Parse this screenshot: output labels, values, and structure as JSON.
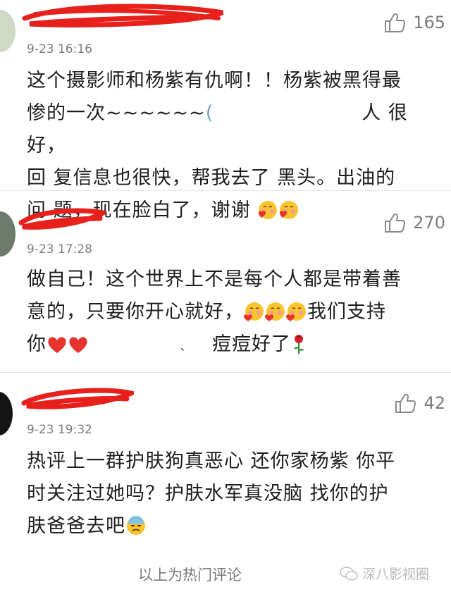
{
  "comments": [
    {
      "likes": "165",
      "time": "9-23 16:16",
      "line1": "这个摄影师和杨紫有仇啊！！杨紫被黑得最",
      "line2a": "惨的一次~~~~~~",
      "line2b": "人 很好，",
      "line3": "回 复信息也很快，帮我去了 黑头。出油的",
      "line4": "问 题，现在脸白了，谢谢"
    },
    {
      "likes": "270",
      "time": "9-23 17:28",
      "line1": "做自己！这个世界上不是每个人都是带着善",
      "line2a": "意的，只要你开心就好，",
      "line2b": "我们支持",
      "line3a": "你",
      "line3b": "、",
      "line3c": "痘痘好了"
    },
    {
      "likes": "42",
      "time": "9-23 19:32",
      "line1": "热评上一群护肤狗真恶心 还你家杨紫 你平",
      "line2": "时关注过她吗？护肤水军真没脑 找你的护",
      "line3": "肤爸爸去吧"
    }
  ],
  "footer": {
    "label": "以上为热门评论",
    "watermark": "深八影视圈"
  },
  "colors": {
    "scribble": "#e8201c",
    "meta": "#7d7d7d",
    "heart": "#e8322c"
  }
}
